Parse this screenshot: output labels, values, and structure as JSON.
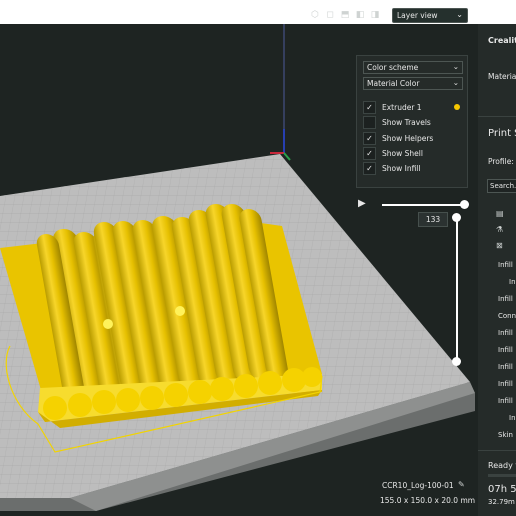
{
  "toolbar": {
    "view_icons": [
      "3d-view-icon",
      "front-view-icon",
      "top-view-icon",
      "left-view-icon",
      "right-view-icon"
    ],
    "view_mode": "Layer view"
  },
  "color_panel": {
    "title": "Color scheme",
    "scheme_value": "Material Color",
    "options": [
      {
        "label": "Extruder 1",
        "checked": true,
        "color": "#f6c700"
      },
      {
        "label": "Show Travels",
        "checked": false
      },
      {
        "label": "Show Helpers",
        "checked": true
      },
      {
        "label": "Show Shell",
        "checked": true
      },
      {
        "label": "Show Infill",
        "checked": true
      }
    ]
  },
  "layer_slider": {
    "current_layer": "133"
  },
  "model": {
    "name": "CCR10_Log-100-01",
    "dimensions": "155.0 x 150.0 x 20.0 mm"
  },
  "right_panel": {
    "printer": "Creality",
    "material": "Material",
    "print_settings": "Print S",
    "profile": "Profile:",
    "search": "Search.",
    "settings": [
      "Infill",
      "In",
      "Infill",
      "Conn",
      "Infill",
      "Infill",
      "Infill",
      "Infill",
      "Infill",
      "In",
      "Skin"
    ],
    "ready": "Ready t",
    "time": "07h 5",
    "length": "32.79m"
  },
  "colors": {
    "background": "#1e2422",
    "bed": "#bcbcbc",
    "model": "#f6d31a",
    "accent": "#f6c700"
  }
}
